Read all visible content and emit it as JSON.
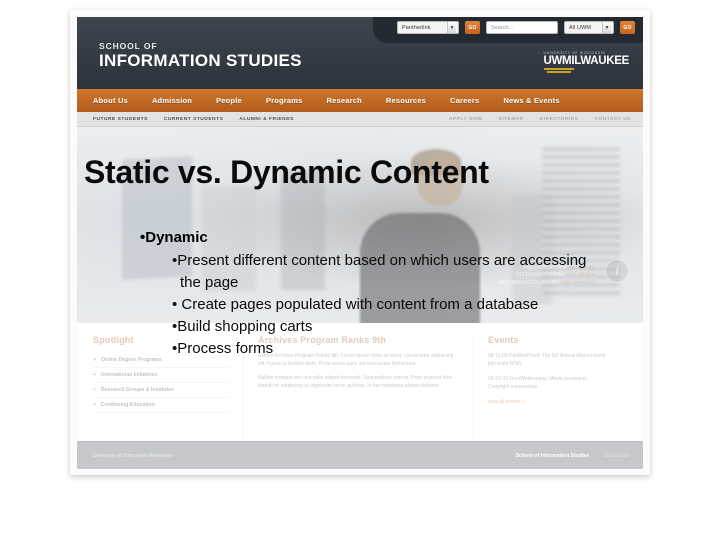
{
  "slide": {
    "title": "Static vs. Dynamic Content",
    "bullet_level1": "•Dynamic",
    "bullets_level2": [
      "•Present different content based on which users are accessing the page",
      "• Create pages populated with content from a database",
      "•Build shopping carts",
      "•Process forms"
    ]
  },
  "website": {
    "topbar": {
      "account_select": "Pantherlink",
      "account_go": "GO",
      "search_placeholder": "Search...",
      "scope_select": "All UWM",
      "search_go": "GO"
    },
    "brand": {
      "line1": "SCHOOL OF",
      "line2": "INFORMATION STUDIES"
    },
    "logo": {
      "tiny": "UNIVERSITY OF WISCONSIN",
      "main": "UWMILWAUKEE"
    },
    "nav": [
      "About Us",
      "Admission",
      "People",
      "Programs",
      "Research",
      "Resources",
      "Careers",
      "News & Events"
    ],
    "subnav_left": [
      "FUTURE STUDENTS",
      "CURRENT STUDENTS",
      "ALUMNI & FRIENDS"
    ],
    "subnav_right": [
      "APPLY NOW",
      "SITEMAP",
      "DIRECTORIES",
      "CONTACT US"
    ],
    "hero": {
      "tagline": [
        {
          "strong": "INFORMATION",
          "rest": " our focus"
        },
        {
          "strong": "INTERNATIONAL",
          "rest": " our scope"
        },
        {
          "strong": "INTERDISCIPLINARY",
          "rest": " our mindset"
        }
      ],
      "info_icon": "i"
    },
    "columns": {
      "spotlight": {
        "heading": "Spotlight",
        "items": [
          "Online Degree Programs",
          "International Initiatives",
          "Research Groups & Institutes",
          "Continuing Education"
        ]
      },
      "news": {
        "heading": "Archives Program Ranks 9th",
        "paragraphs": [
          "School Archives Program Ranks 9th. Lorem ipsum dolor sit amet, consectetur adipiscing elit. Fusce ut facilisis diam. Proin luctus nunc vel sem luctus fermentum.",
          "Nullam tristique orci sed nulla aliquet hendrerit. Suspendisse potenti. Proin pulvinar felis blandit mi adipiscing ac dignissim lorem pulvinar. In hac habitasse platea dictumst."
        ]
      },
      "events": {
        "heading": "Events",
        "items": [
          "09-11-09  PantherProwl: The 5th Annual Alumni event join team SOIS",
          "09-23-09  One/Wednesday: Movie screening, Copyright copywrongs"
        ],
        "link": "view all events »"
      }
    },
    "footer": {
      "left": "University of Wisconsin-Milwaukee",
      "school": "School of Information Studies",
      "contact": "Contact Us"
    }
  },
  "colors": {
    "nav_orange": "#c06a24",
    "header_dark": "#353c45",
    "accent_tan": "#c98b5e",
    "footer_gray": "#c6c8cc",
    "gold": "#c9a227"
  }
}
